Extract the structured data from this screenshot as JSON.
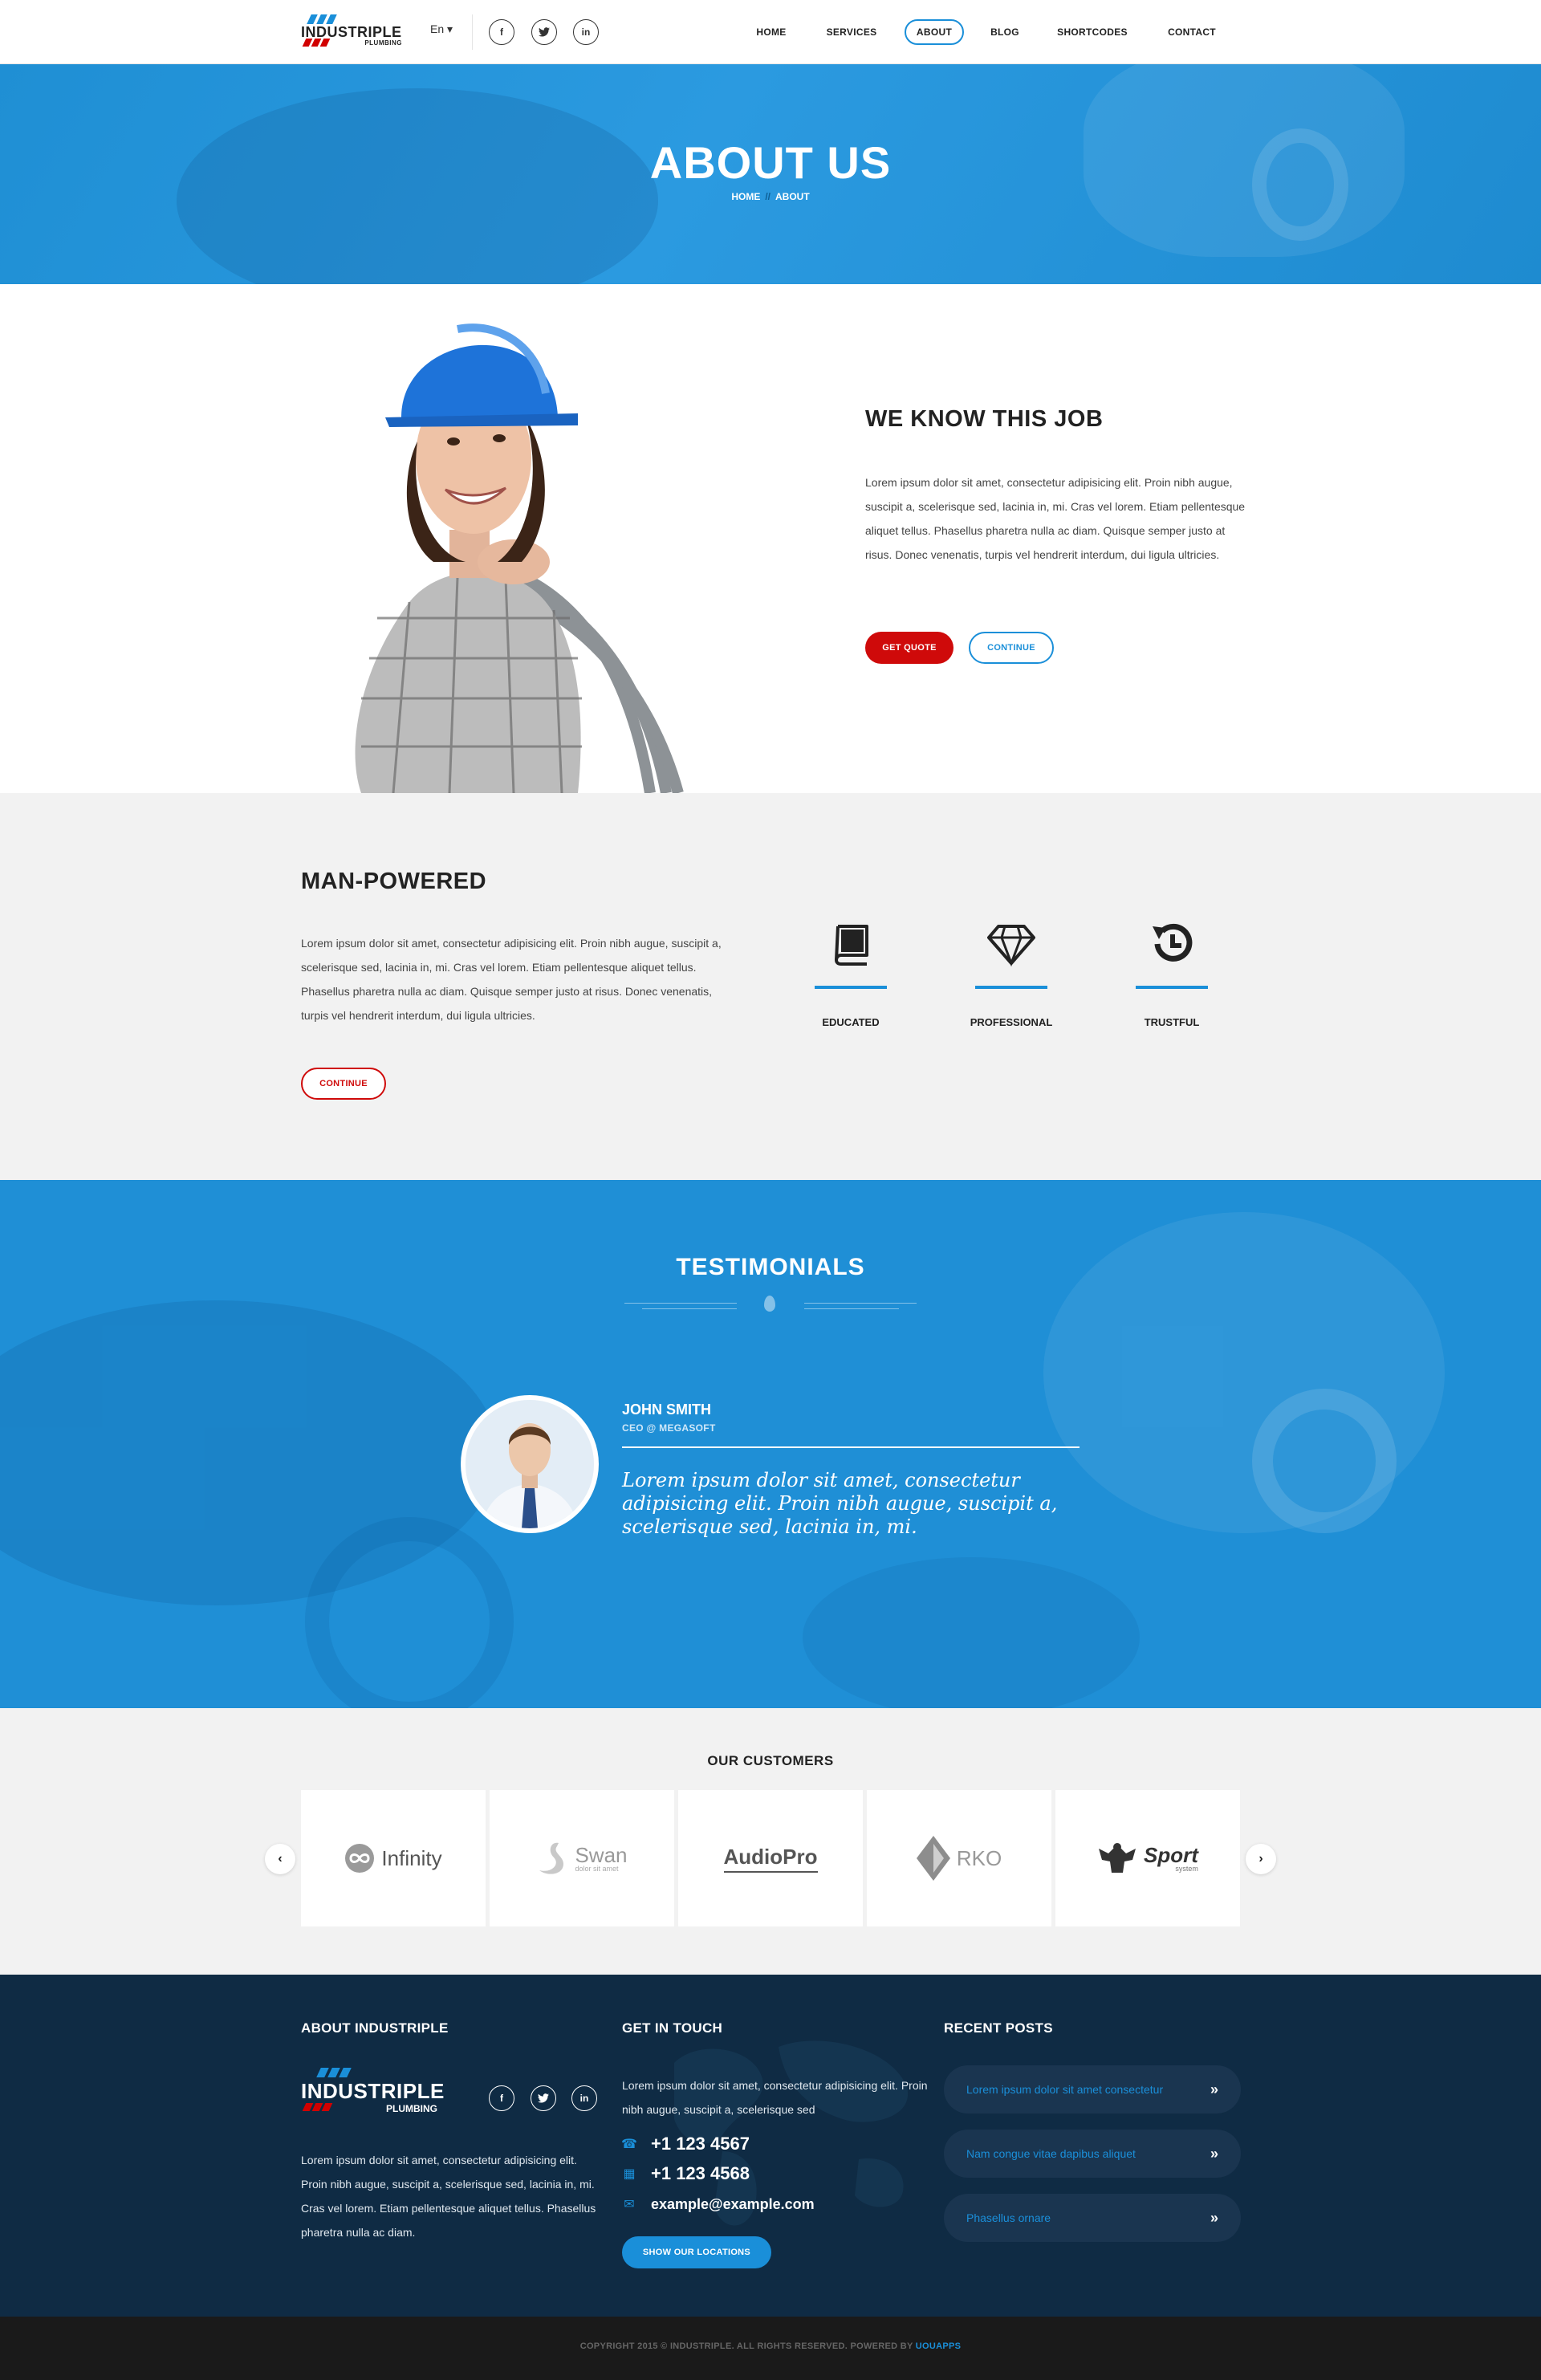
{
  "brand": {
    "name": "INDUSTRIPLE",
    "sub": "PLUMBING"
  },
  "header": {
    "lang": "En ▾",
    "social": [
      "f",
      "t",
      "in"
    ],
    "nav": [
      {
        "label": "HOME",
        "active": false
      },
      {
        "label": "SERVICES",
        "active": false
      },
      {
        "label": "ABOUT",
        "active": true
      },
      {
        "label": "BLOG",
        "active": false
      },
      {
        "label": "SHORTCODES",
        "active": false
      },
      {
        "label": "CONTACT",
        "active": false
      }
    ]
  },
  "hero": {
    "title": "ABOUT US",
    "crumb_home": "HOME",
    "crumb_sep": "//",
    "crumb_current": "ABOUT"
  },
  "job": {
    "title": "WE KNOW THIS JOB",
    "text": "Lorem ipsum dolor sit amet, consectetur adipisicing elit. Proin nibh augue, suscipit a, scelerisque sed, lacinia in, mi. Cras vel lorem. Etiam pellentesque aliquet tellus. Phasellus pharetra nulla ac diam. Quisque semper justo at risus. Donec venenatis, turpis vel hendrerit interdum, dui ligula ultricies.",
    "btn_quote": "GET QUOTE",
    "btn_continue": "CONTINUE"
  },
  "manpowered": {
    "title": "MAN-POWERED",
    "text": "Lorem ipsum dolor sit amet, consectetur adipisicing elit. Proin nibh augue, suscipit a, scelerisque sed, lacinia in, mi. Cras vel lorem. Etiam pellentesque aliquet tellus. Phasellus pharetra nulla ac diam. Quisque semper justo at risus. Donec venenatis, turpis vel hendrerit interdum, dui ligula ultricies.",
    "btn_continue": "CONTINUE",
    "features": [
      {
        "label": "EDUCATED",
        "icon": "book-icon"
      },
      {
        "label": "PROFESSIONAL",
        "icon": "diamond-icon"
      },
      {
        "label": "TRUSTFUL",
        "icon": "history-icon"
      }
    ]
  },
  "testimonials": {
    "title": "TESTIMONIALS",
    "name": "JOHN SMITH",
    "role": "CEO @ MEGASOFT",
    "quote": "Lorem ipsum dolor sit amet, consectetur adipisicing elit. Proin nibh augue, suscipit a, scelerisque sed, lacinia in, mi."
  },
  "customers": {
    "title": "OUR CUSTOMERS",
    "logos": [
      "Infinity",
      "Swan",
      "AudioPro",
      "RKO",
      "Sport"
    ],
    "swan_tag": "dolor sit amet",
    "sport_tag": "system"
  },
  "footer": {
    "about_title": "ABOUT INDUSTRIPLE",
    "about_text": "Lorem ipsum dolor sit amet, consectetur adipisicing elit. Proin nibh augue, suscipit a, scelerisque sed, lacinia in, mi. Cras vel lorem. Etiam pellentesque aliquet tellus. Phasellus pharetra nulla ac diam.",
    "touch_title": "GET IN TOUCH",
    "touch_text": "Lorem ipsum dolor sit amet, consectetur adipisicing elit. Proin nibh augue, suscipit a, scelerisque sed",
    "phone1": "+1 123 4567",
    "phone2": "+1 123 4568",
    "email": "example@example.com",
    "locations_btn": "SHOW OUR LOCATIONS",
    "posts_title": "RECENT POSTS",
    "posts": [
      "Lorem ipsum dolor sit amet consectetur",
      "Nam congue vitae dapibus aliquet",
      "Phasellus ornare"
    ],
    "copyright": "COPYRIGHT 2015 © INDUSTRIPLE. ALL RIGHTS RESERVED. POWERED BY",
    "powered": "UOUAPPS"
  },
  "colors": {
    "accent": "#1a8fd9",
    "red": "#cf0a0a",
    "footer": "#0f2b44"
  }
}
